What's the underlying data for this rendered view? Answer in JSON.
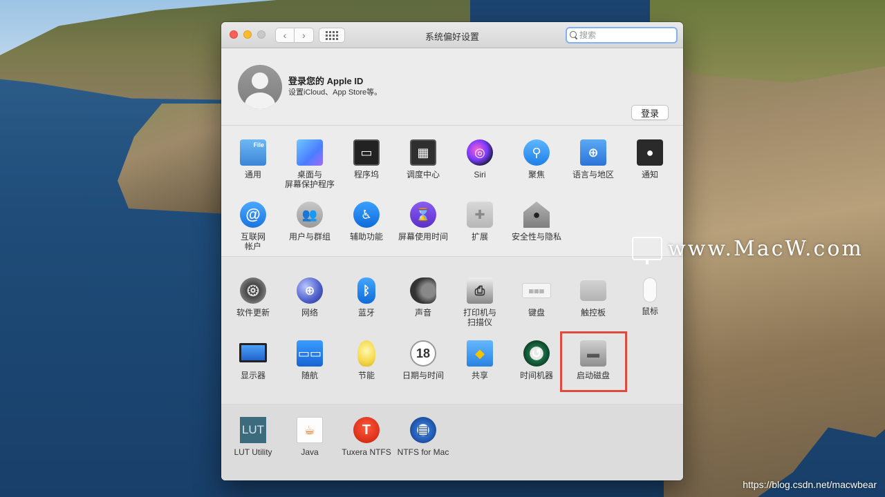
{
  "window": {
    "title": "系统偏好设置"
  },
  "search": {
    "placeholder": "搜索"
  },
  "account": {
    "title": "登录您的 Apple ID",
    "subtitle": "设置iCloud、App Store等。",
    "login_label": "登录"
  },
  "section1": [
    {
      "label": "通用",
      "icon": "general-icon",
      "glyph": "File"
    },
    {
      "label": "桌面与\n屏幕保护程序",
      "icon": "desktop-screensaver-icon",
      "glyph": ""
    },
    {
      "label": "程序坞",
      "icon": "dock-icon",
      "glyph": "▭"
    },
    {
      "label": "调度中心",
      "icon": "mission-control-icon",
      "glyph": "▦"
    },
    {
      "label": "Siri",
      "icon": "siri-icon",
      "glyph": "◎"
    },
    {
      "label": "聚焦",
      "icon": "spotlight-icon",
      "glyph": "⚲"
    },
    {
      "label": "语言与地区",
      "icon": "language-region-icon",
      "glyph": "⊕"
    },
    {
      "label": "通知",
      "icon": "notifications-icon",
      "glyph": "●"
    },
    {
      "label": "互联网\n帐户",
      "icon": "internet-accounts-icon",
      "glyph": "@"
    },
    {
      "label": "用户与群组",
      "icon": "users-groups-icon",
      "glyph": "👥"
    },
    {
      "label": "辅助功能",
      "icon": "accessibility-icon",
      "glyph": "♿"
    },
    {
      "label": "屏幕使用时间",
      "icon": "screen-time-icon",
      "glyph": "⌛"
    },
    {
      "label": "扩展",
      "icon": "extensions-icon",
      "glyph": "✚"
    },
    {
      "label": "安全性与隐私",
      "icon": "security-privacy-icon",
      "glyph": "●"
    }
  ],
  "section2": [
    {
      "label": "软件更新",
      "icon": "software-update-icon",
      "glyph": "⚙"
    },
    {
      "label": "网络",
      "icon": "network-icon",
      "glyph": "⊕"
    },
    {
      "label": "蓝牙",
      "icon": "bluetooth-icon",
      "glyph": "ᛒ"
    },
    {
      "label": "声音",
      "icon": "sound-icon",
      "glyph": ""
    },
    {
      "label": "打印机与\n扫描仪",
      "icon": "printers-scanners-icon",
      "glyph": "⎙"
    },
    {
      "label": "键盘",
      "icon": "keyboard-icon",
      "glyph": "▦▦▦"
    },
    {
      "label": "触控板",
      "icon": "trackpad-icon",
      "glyph": ""
    },
    {
      "label": "鼠标",
      "icon": "mouse-icon",
      "glyph": ""
    },
    {
      "label": "显示器",
      "icon": "displays-icon",
      "glyph": ""
    },
    {
      "label": "随航",
      "icon": "sidecar-icon",
      "glyph": "▭▭"
    },
    {
      "label": "节能",
      "icon": "energy-saver-icon",
      "glyph": ""
    },
    {
      "label": "日期与时间",
      "icon": "date-time-icon",
      "glyph": "18"
    },
    {
      "label": "共享",
      "icon": "sharing-icon",
      "glyph": "◆"
    },
    {
      "label": "时间机器",
      "icon": "time-machine-icon",
      "glyph": "↺"
    },
    {
      "label": "启动磁盘",
      "icon": "startup-disk-icon",
      "glyph": "▬"
    }
  ],
  "section3": [
    {
      "label": "LUT Utility",
      "icon": "lut-utility-icon",
      "glyph": "LUT"
    },
    {
      "label": "Java",
      "icon": "java-icon",
      "glyph": "☕"
    },
    {
      "label": "Tuxera NTFS",
      "icon": "tuxera-ntfs-icon",
      "glyph": "T"
    },
    {
      "label": "NTFS for Mac",
      "icon": "ntfs-for-mac-icon",
      "glyph": "▤"
    }
  ],
  "watermark": {
    "text": "www.MacW.com"
  },
  "csdn": {
    "text": "https://blog.csdn.net/macwbear"
  },
  "colors": {
    "highlight": "#e04a3e",
    "search_focus": "#7fb1f5"
  }
}
